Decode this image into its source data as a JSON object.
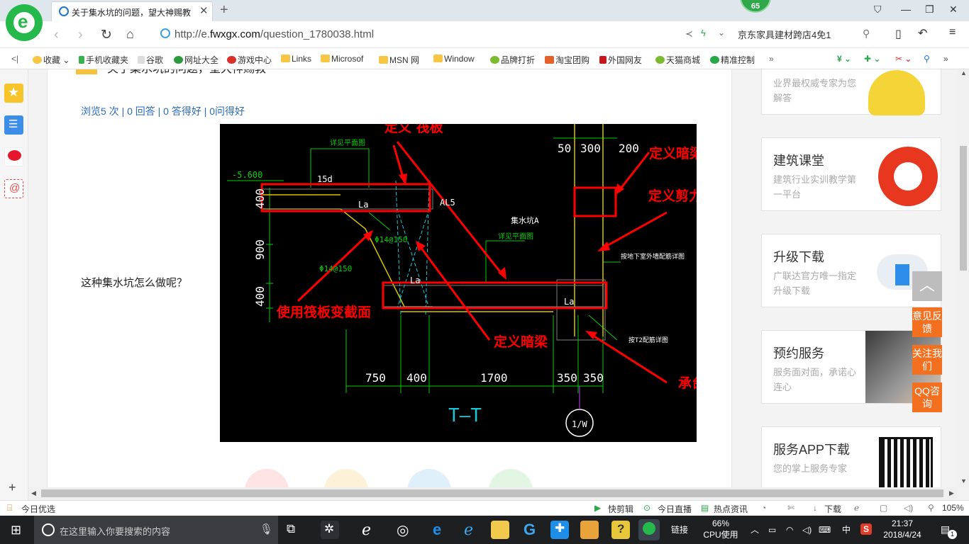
{
  "browser": {
    "badge": "65",
    "tab_title": "关于集水坑的问题，望大神赐教",
    "url_prefix": "http://e.",
    "url_domain": "fwxgx.com",
    "url_path": "/question_1780038.html",
    "search_box": "京东家具建材跨店4免1",
    "bookmarks": [
      "收藏",
      "手机收藏夹",
      "谷歌",
      "网址大全",
      "游戏中心",
      "Links",
      "Microsof",
      "MSN 网",
      "Window",
      "品牌打折",
      "淘宝团购",
      "外国网友",
      "天猫商城",
      "精准控制"
    ]
  },
  "question": {
    "title": "关于集水坑的问题，望大神赐教",
    "stats": "浏览5 次 | 0 回答 | 0 答得好 | 0问得好",
    "body": "这种集水坑怎么做呢？"
  },
  "cad": {
    "red_labels": [
      "定义 筏板",
      "定义暗梁",
      "定义剪力墙",
      "使用筏板变截面",
      "定义暗梁",
      "承台"
    ],
    "dims_top": [
      "50",
      "300",
      "200"
    ],
    "dims_bottom": [
      "750",
      "400",
      "1700",
      "350",
      "350"
    ],
    "dims_left": [
      "400",
      "900",
      "400"
    ],
    "texts": [
      "-5.600",
      "详见平面图",
      "15d",
      "La",
      "AL5",
      "集水坑A",
      "详见平面图",
      "Φ14@150",
      "Φ14@150",
      "La",
      "La",
      "按地下室外墙配筋详图",
      "按T2配筋详图",
      "T—T",
      "1/W"
    ]
  },
  "sidebar": [
    {
      "title": "",
      "desc": "业界最权威专家为您解答"
    },
    {
      "title": "建筑课堂",
      "desc": "建筑行业实训教学第一平台"
    },
    {
      "title": "升级下载",
      "desc": "广联达官方唯一指定升级下载"
    },
    {
      "title": "预约服务",
      "desc": "服务面对面，承诺心连心"
    },
    {
      "title": "服务APP下载",
      "desc": "您的掌上服务专家"
    }
  ],
  "float_buttons": [
    "意见反馈",
    "关注我们",
    "QQ咨询"
  ],
  "statusbar": {
    "left": "今日优选",
    "items": [
      "快剪辑",
      "今日直播",
      "热点资讯",
      "下载",
      "105%"
    ]
  },
  "taskbar": {
    "search_placeholder": "在这里输入你要搜索的内容",
    "links": "链接",
    "cpu_pct": "66%",
    "cpu_label": "CPU使用",
    "ime": "中",
    "time": "21:37",
    "date": "2018/4/24",
    "notif": "1"
  },
  "colors": {
    "accent_green": "#25b84a",
    "link_blue": "#2b6cb8",
    "orange": "#f37021",
    "cad_red": "#ff0000"
  }
}
